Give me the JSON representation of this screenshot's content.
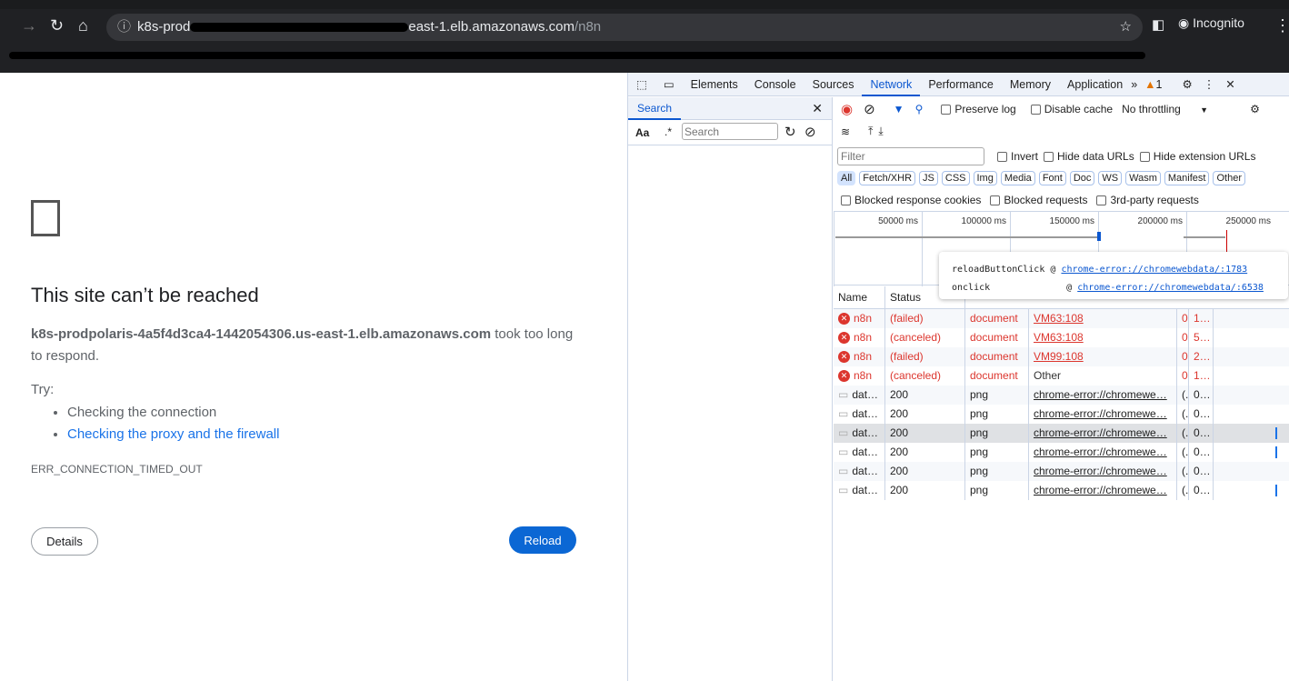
{
  "browser": {
    "url_host_start": "k8s-prod",
    "url_host_end": "east-1.elb.amazonaws.com",
    "url_path": "/n8n",
    "profile": "Incognito"
  },
  "error_page": {
    "title": "This site can’t be reached",
    "host": "k8s-prodpolaris-4a5f4d3ca4-1442054306.us-east-1.elb.amazonaws.com",
    "desc_suffix": " took too long to respond.",
    "try": "Try:",
    "suggestions": [
      "Checking the connection",
      "Checking the proxy and the firewall"
    ],
    "code": "ERR_CONNECTION_TIMED_OUT",
    "details": "Details",
    "reload": "Reload"
  },
  "devtools": {
    "tabs": [
      "Elements",
      "Console",
      "Sources",
      "Network",
      "Performance",
      "Memory",
      "Application"
    ],
    "warnings": "1",
    "search": {
      "tab": "Search",
      "case": "Aa",
      "regex": ".*",
      "placeholder": "Search"
    },
    "network": {
      "preserve_log": "Preserve log",
      "disable_cache": "Disable cache",
      "throttling": "No throttling",
      "filter_placeholder": "Filter",
      "invert": "Invert",
      "hide_data": "Hide data URLs",
      "hide_ext": "Hide extension URLs",
      "types": [
        "All",
        "Fetch/XHR",
        "JS",
        "CSS",
        "Img",
        "Media",
        "Font",
        "Doc",
        "WS",
        "Wasm",
        "Manifest",
        "Other"
      ],
      "blocked_cookies": "Blocked response cookies",
      "blocked_requests": "Blocked requests",
      "third_party": "3rd-party requests",
      "ticks": [
        "50000 ms",
        "100000 ms",
        "150000 ms",
        "200000 ms",
        "250000 ms"
      ],
      "columns": {
        "name": "Name",
        "status": "Status"
      },
      "tooltip": {
        "fn1": "reloadButtonClick",
        "link1": "chrome-error://chromewebdata/:1783",
        "fn2": "onclick",
        "link2": "chrome-error://chromewebdata/:6538",
        "at": "@"
      },
      "rows": [
        {
          "name": "n8n",
          "status": "(failed)",
          "type": "document",
          "initiator": "VM63:108",
          "size": "0.",
          "time": "1…",
          "error": true,
          "link": true
        },
        {
          "name": "n8n",
          "status": "(canceled)",
          "type": "document",
          "initiator": "VM63:108",
          "size": "0.",
          "time": "5…",
          "error": true,
          "link": true
        },
        {
          "name": "n8n",
          "status": "(failed)",
          "type": "document",
          "initiator": "VM99:108",
          "size": "0.",
          "time": "2…",
          "error": true,
          "link": true
        },
        {
          "name": "n8n",
          "status": "(canceled)",
          "type": "document",
          "initiator": "Other",
          "size": "0.",
          "time": "1…",
          "error": true,
          "link": false
        },
        {
          "name": "dat…",
          "status": "200",
          "type": "png",
          "initiator": "chrome-error://chromewe…",
          "size": "(..",
          "time": "0…",
          "error": false,
          "link": true
        },
        {
          "name": "dat…",
          "status": "200",
          "type": "png",
          "initiator": "chrome-error://chromewe…",
          "size": "(..",
          "time": "0…",
          "error": false,
          "link": true
        },
        {
          "name": "dat…",
          "status": "200",
          "type": "png",
          "initiator": "chrome-error://chromewe…",
          "size": "(..",
          "time": "0…",
          "error": false,
          "link": true
        },
        {
          "name": "dat…",
          "status": "200",
          "type": "png",
          "initiator": "chrome-error://chromewe…",
          "size": "(..",
          "time": "0…",
          "error": false,
          "link": true
        },
        {
          "name": "dat…",
          "status": "200",
          "type": "png",
          "initiator": "chrome-error://chromewe…",
          "size": "(..",
          "time": "0…",
          "error": false,
          "link": true
        },
        {
          "name": "dat…",
          "status": "200",
          "type": "png",
          "initiator": "chrome-error://chromewe…",
          "size": "(..",
          "time": "0…",
          "error": false,
          "link": true
        }
      ]
    }
  }
}
